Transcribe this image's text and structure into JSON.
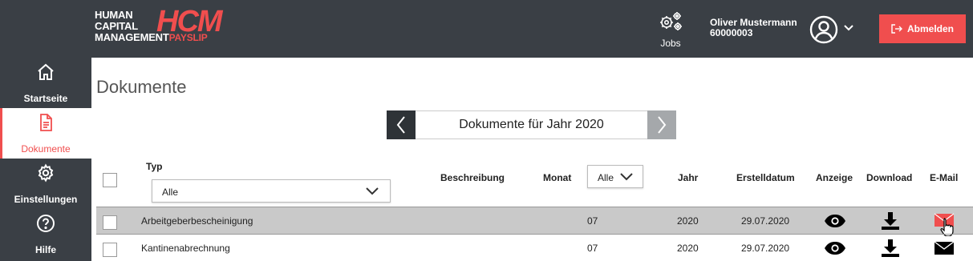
{
  "header": {
    "logo": {
      "line1": "HUMAN",
      "line2": "CAPITAL",
      "line3": "MANAGEMENT",
      "brand": "HCM",
      "product": "PAYSLIP"
    },
    "jobs_label": "Jobs",
    "user_name": "Oliver Mustermann",
    "user_id": "60000003",
    "logout_label": "Abmelden"
  },
  "sidebar": {
    "items": [
      {
        "label": "Startseite",
        "icon": "home-icon"
      },
      {
        "label": "Dokumente",
        "icon": "document-icon",
        "active": true
      },
      {
        "label": "Einstellungen",
        "icon": "gear-icon"
      },
      {
        "label": "Hilfe",
        "icon": "help-icon"
      }
    ]
  },
  "main": {
    "page_title": "Dokumente",
    "year_label": "Dokumente für Jahr 2020",
    "columns": {
      "typ": "Typ",
      "beschreibung": "Beschreibung",
      "monat": "Monat",
      "jahr": "Jahr",
      "erstelldatum": "Erstelldatum",
      "anzeige": "Anzeige",
      "download": "Download",
      "email": "E-Mail"
    },
    "typ_filter": "Alle",
    "monat_filter": "Alle",
    "rows": [
      {
        "typ": "Arbeitgeberbescheinigung",
        "beschreibung": "",
        "monat": "07",
        "jahr": "2020",
        "erstelldatum": "29.07.2020",
        "selected": true
      },
      {
        "typ": "Kantinenabrechnung",
        "beschreibung": "",
        "monat": "07",
        "jahr": "2020",
        "erstelldatum": "29.07.2020",
        "selected": false
      }
    ]
  },
  "colors": {
    "dark": "#3a3f45",
    "accent": "#f04e4e",
    "row_selected": "#c9c9c9"
  }
}
